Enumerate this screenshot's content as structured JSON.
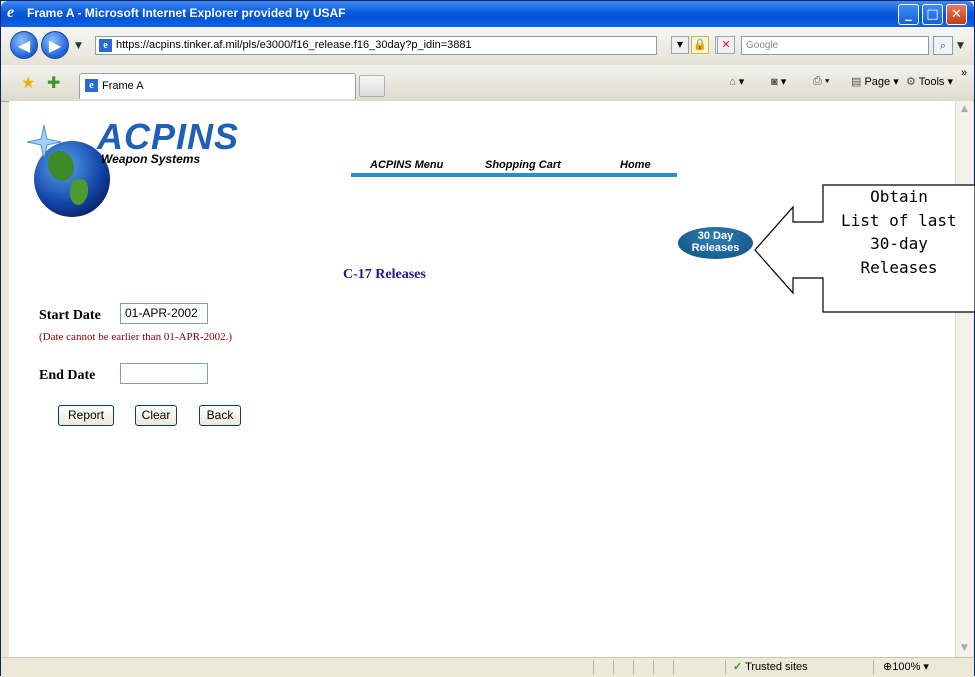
{
  "window": {
    "title": "Frame A - Microsoft Internet Explorer provided by USAF"
  },
  "address_bar": {
    "url": "https://acpins.tinker.af.mil/pls/e3000/f16_release.f16_30day?p_idin=3881",
    "search_placeholder": "Google"
  },
  "tabs": [
    {
      "label": "Frame A"
    }
  ],
  "command_bar": {
    "page_label": "Page",
    "tools_label": "Tools"
  },
  "logo": {
    "brand": "ACPINS",
    "subtitle": "Weapon Systems"
  },
  "nav": {
    "items": [
      "ACPINS Menu",
      "Shopping Cart",
      "Home"
    ]
  },
  "releases_button": {
    "line1": "30 Day",
    "line2": "Releases"
  },
  "page": {
    "title": "C-17 Releases"
  },
  "form": {
    "start_date_label": "Start Date",
    "start_date_value": "01-APR-2002",
    "start_date_note": "(Date cannot be earlier than 01-APR-2002.)",
    "end_date_label": "End Date",
    "end_date_value": "",
    "buttons": [
      "Report",
      "Clear",
      "Back"
    ]
  },
  "callout": {
    "lines": [
      "Obtain",
      "List of last",
      "30-day",
      "Releases"
    ]
  },
  "status_bar": {
    "zone": "Trusted sites",
    "zoom": "100%"
  }
}
